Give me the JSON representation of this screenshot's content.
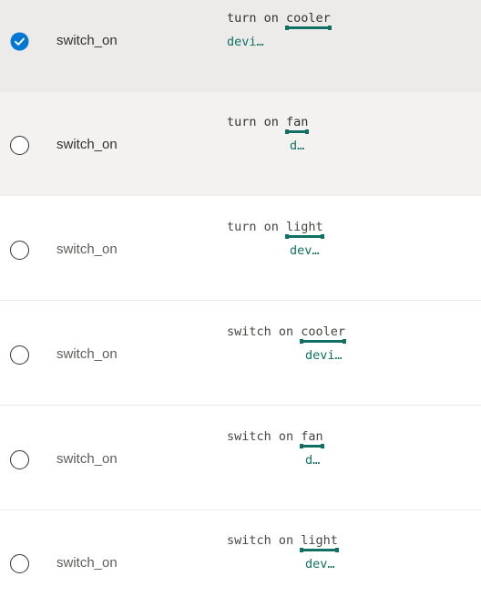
{
  "colors": {
    "accent": "#0078d4",
    "entity": "#0f7063",
    "selected_row": "#edebe9",
    "hover_row": "#f3f2f1"
  },
  "rows": [
    {
      "intent": "switch_on",
      "utterance_prefix": "turn on ",
      "entity": "cooler",
      "entity_type": "devi…",
      "checked": true,
      "state": "selected"
    },
    {
      "intent": "switch_on",
      "utterance_prefix": "turn on ",
      "entity": "fan",
      "entity_type": "d…",
      "checked": false,
      "state": "hover"
    },
    {
      "intent": "switch_on",
      "utterance_prefix": "turn on ",
      "entity": "light",
      "entity_type": "dev…",
      "checked": false,
      "state": "normal"
    },
    {
      "intent": "switch_on",
      "utterance_prefix": "switch on ",
      "entity": "cooler",
      "entity_type": "devi…",
      "checked": false,
      "state": "normal"
    },
    {
      "intent": "switch_on",
      "utterance_prefix": "switch on ",
      "entity": "fan",
      "entity_type": "d…",
      "checked": false,
      "state": "normal"
    },
    {
      "intent": "switch_on",
      "utterance_prefix": "switch on ",
      "entity": "light",
      "entity_type": "dev…",
      "checked": false,
      "state": "normal"
    }
  ]
}
